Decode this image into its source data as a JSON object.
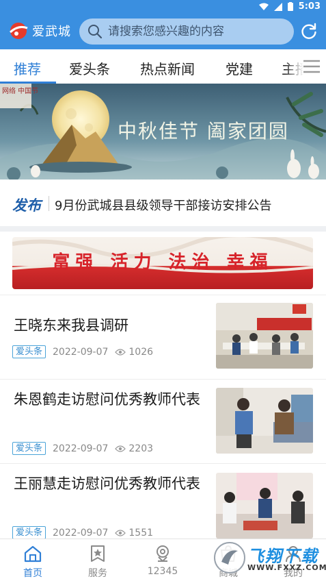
{
  "status_bar": {
    "time": "5:03"
  },
  "header": {
    "app_name": "爱武城",
    "search_placeholder": "请搜索您感兴趣的内容"
  },
  "tabs": [
    {
      "label": "推荐",
      "active": true
    },
    {
      "label": "爱头条"
    },
    {
      "label": "热点新闻"
    },
    {
      "label": "党建"
    },
    {
      "label": "主播"
    }
  ],
  "banner": {
    "title": "中秋佳节 阖家团圆",
    "seal_text": "网络 中国节"
  },
  "announcement": {
    "tag": "发布",
    "text": "9月份武城县县级领导干部接访安排公告"
  },
  "slogan": {
    "text": "富强 活力 法治 幸福"
  },
  "news": [
    {
      "title": "王晓东来我县调研",
      "category": "爱头条",
      "date": "2022-09-07",
      "views": "1026"
    },
    {
      "title": "朱恩鹤走访慰问优秀教师代表",
      "category": "爱头条",
      "date": "2022-09-07",
      "views": "2203"
    },
    {
      "title": "王丽慧走访慰问优秀教师代表",
      "category": "爱头条",
      "date": "2022-09-07",
      "views": "1551"
    }
  ],
  "bottom_nav": [
    {
      "label": "首页",
      "icon": "home-icon",
      "active": true
    },
    {
      "label": "服务",
      "icon": "star-bookmark-icon"
    },
    {
      "label": "12345",
      "icon": "location-pin-icon"
    },
    {
      "label": "商城",
      "icon": "shop-icon"
    },
    {
      "label": "我的",
      "icon": "user-icon"
    }
  ],
  "watermark": {
    "text": "飞翔下载",
    "url": "WWW.FXXZ.COM"
  },
  "colors": {
    "primary": "#3a8fe0",
    "active_tab": "#2f7fd6",
    "slogan_red": "#d7232a"
  }
}
